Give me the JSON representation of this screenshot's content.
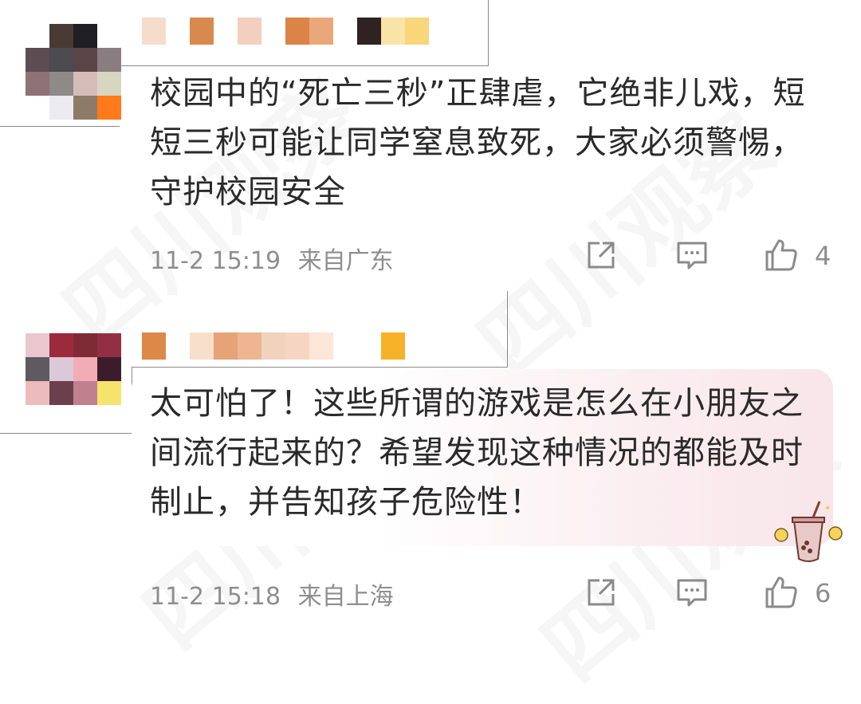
{
  "watermark": "四川观察",
  "comments": [
    {
      "avatar_colors": [
        "#ffffff",
        "#4a3a36",
        "#1f1f24",
        "#ffffff",
        "#5b4d52",
        "#4d4a50",
        "#5a4446",
        "#8a7d82",
        "#8f7275",
        "#8d8a88",
        "#d6bcb8",
        "#d8d5c0",
        "#ffffff",
        "#ecebf2",
        "#8d7a68",
        "#ff7a1a"
      ],
      "username_colors": [
        "#f6dccb",
        "#ffffff",
        "#d88a4e",
        "#ffffff",
        "#f3cfbf",
        "#ffffff",
        "#dc8448",
        "#eaa77a",
        "#ffffff",
        "#2e2222",
        "#f9e4a7",
        "#f7d77a"
      ],
      "text": "校园中的“死亡三秒”正肆虐，它绝非儿戏，短短三秒可能让同学窒息致死，大家必须警惕，守护校园安全",
      "date": "11-2 15:19",
      "location": "来自广东",
      "likes": "4"
    },
    {
      "avatar_colors": [
        "#e8c7cf",
        "#9b2a3c",
        "#7e2b35",
        "#932f44",
        "#5e5a5f",
        "#dcc9d8",
        "#f2acb6",
        "#3c1c2b",
        "#ecbcbc",
        "#6c3f4c",
        "#c0808f",
        "#f6e36e",
        "#ffffff",
        "#ffffff",
        "#ffffff",
        "#ffffff"
      ],
      "username_colors": [
        "#dc8848",
        "#ffffff",
        "#f8dfcb",
        "#e6a377",
        "#eeb591",
        "#f1d2bd",
        "#f6d6c2",
        "#fbe6d8",
        "#ffffff",
        "#ffffff",
        "#f7b22a"
      ],
      "text": "太可怕了！这些所谓的游戏是怎么在小朋友之间流行起来的？希望发现这种情况的都能及时制止，并告知孩子危险性！",
      "date": "11-2 15:18",
      "location": "来自上海",
      "likes": "6"
    }
  ],
  "icons": {
    "share": "share-icon",
    "reply": "reply-icon",
    "like": "like-icon",
    "sticker": "bubble-tea-sticker"
  },
  "colors": {
    "meta": "#8e8e8e",
    "text": "#2a2a2a",
    "bubble_tint": "#f8e5ea"
  }
}
